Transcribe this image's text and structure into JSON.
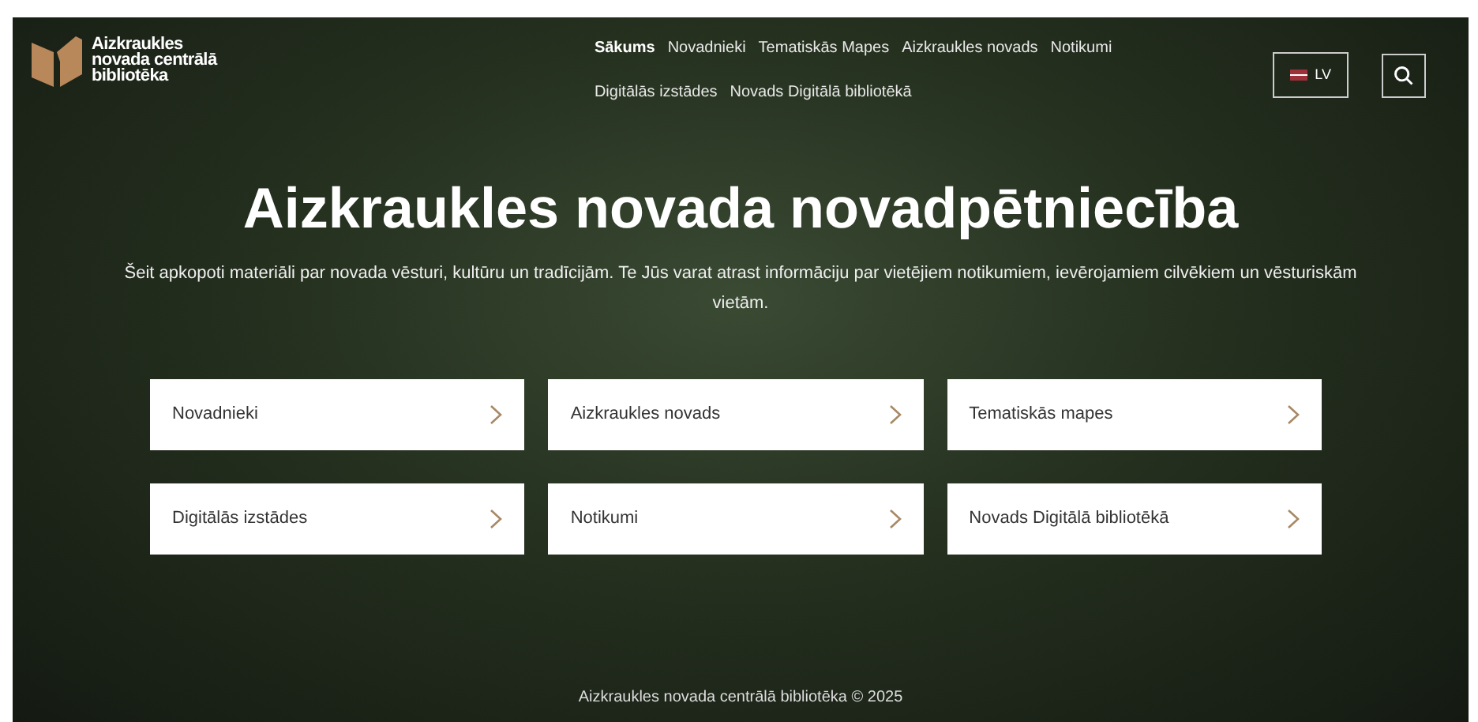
{
  "logo": {
    "lines": [
      "Aizkraukles",
      "novada centrālā",
      "bibliotēka"
    ]
  },
  "nav": [
    {
      "label": "Sākums",
      "selected": true
    },
    {
      "label": "Novadnieki",
      "selected": false
    },
    {
      "label": "Tematiskās Mapes",
      "selected": false
    },
    {
      "label": "Aizkraukles novads",
      "selected": false
    },
    {
      "label": "Notikumi",
      "selected": false
    },
    {
      "label": "Digitālās izstādes",
      "selected": false
    },
    {
      "label": "Novads Digitālā bibliotēkā",
      "selected": false
    }
  ],
  "language": {
    "code": "LV"
  },
  "hero": {
    "title": "Aizkraukles novada novadpētniecība",
    "text": "Šeit apkopoti materiāli par novada vēsturi, kultūru un tradīcijām. Te Jūs varat atrast informāciju par vietējiem notikumiem, ievērojamiem cilvēkiem un vēsturiskām vietām."
  },
  "cards": [
    {
      "label": "Novadnieki"
    },
    {
      "label": "Aizkraukles novads"
    },
    {
      "label": "Tematiskās mapes"
    },
    {
      "label": "Digitālās izstādes"
    },
    {
      "label": "Notikumi"
    },
    {
      "label": "Novads Digitālā bibliotēkā"
    }
  ],
  "footer": "Aizkraukles novada centrālā bibliotēka © 2025"
}
